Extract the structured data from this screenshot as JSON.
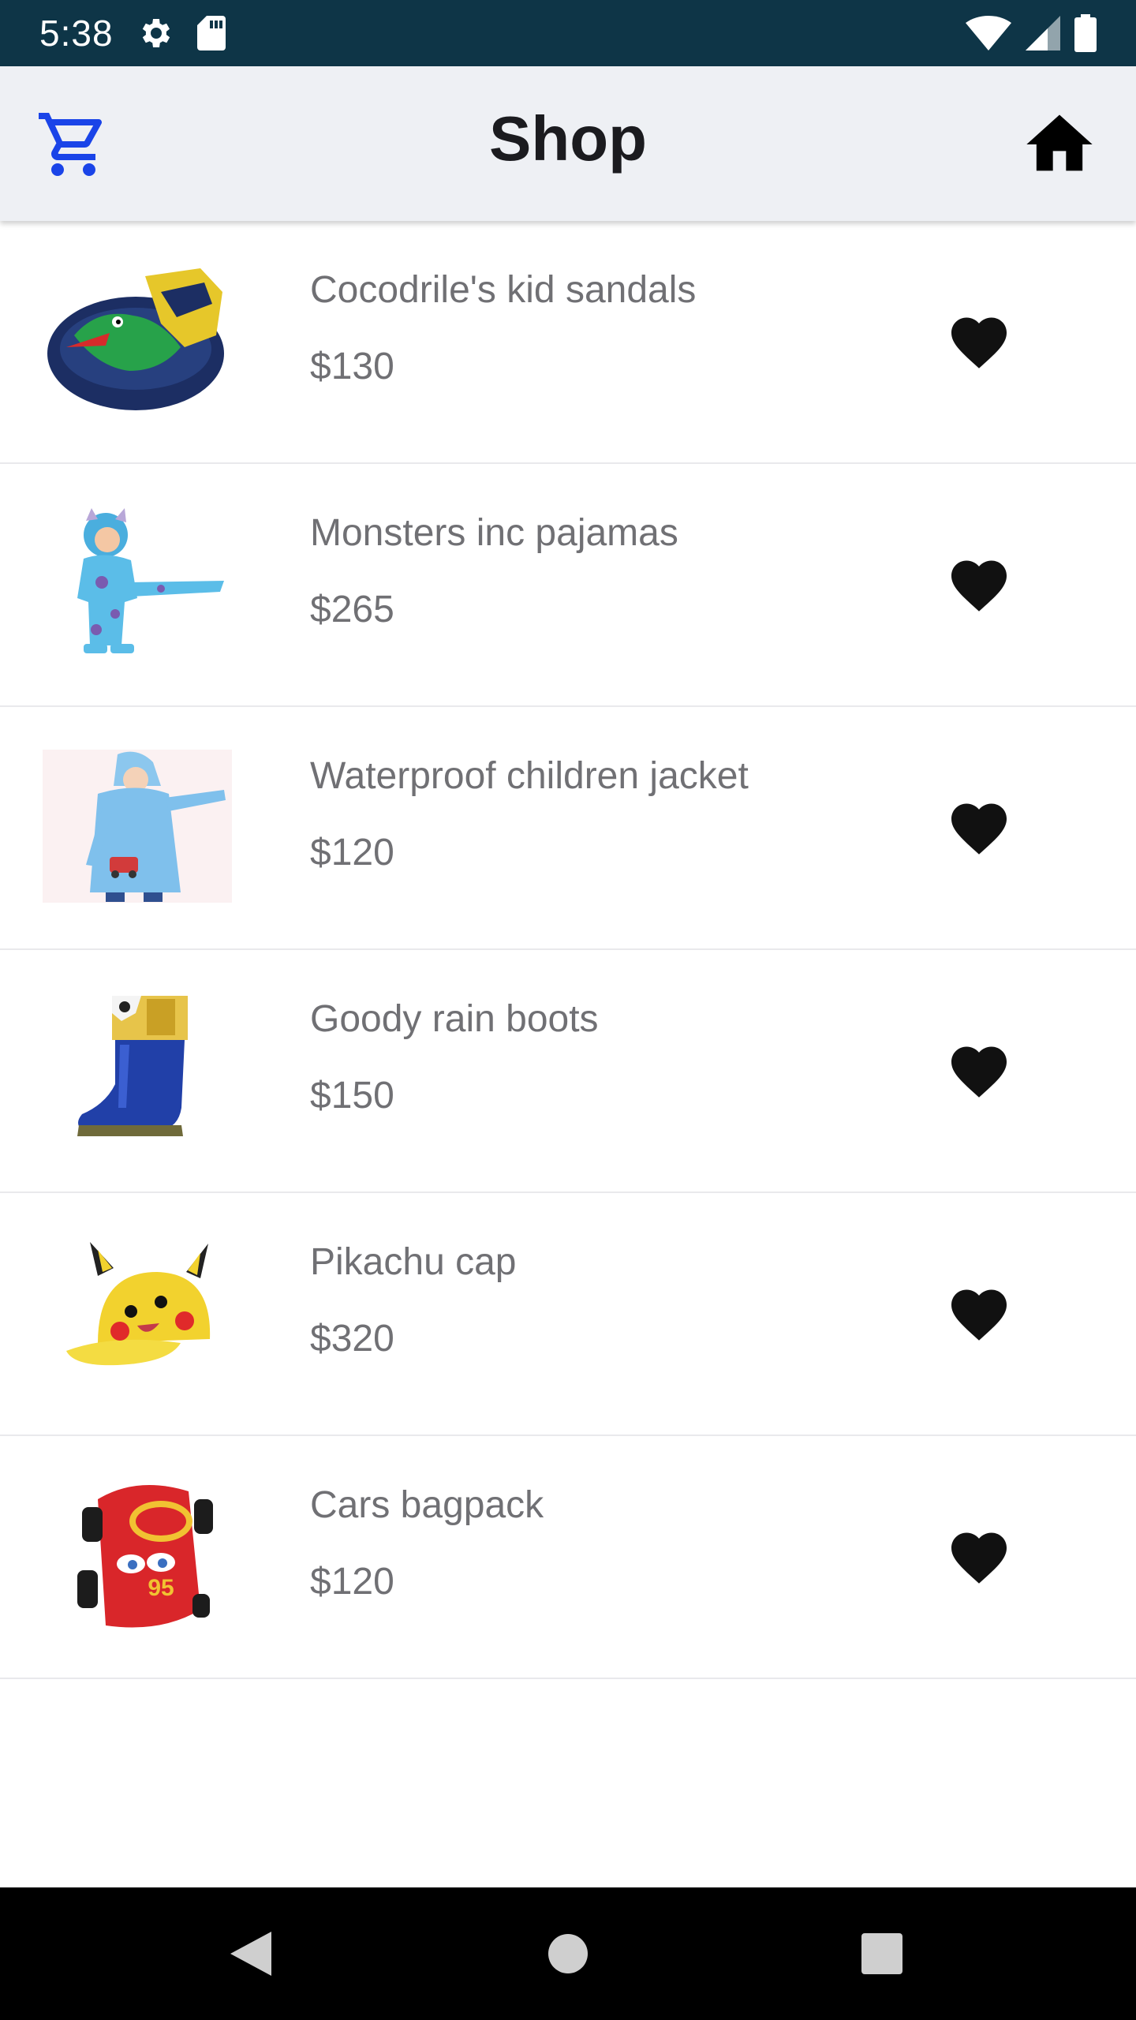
{
  "status_bar": {
    "time": "5:38",
    "icons": [
      "settings-icon",
      "sd-card-icon",
      "wifi-icon",
      "signal-icon",
      "battery-icon"
    ]
  },
  "app_bar": {
    "title": "Shop",
    "cart_icon": "shopping-cart-icon",
    "home_icon": "home-icon",
    "accent_color": "#1a44e8"
  },
  "products": [
    {
      "name": "Cocodrile's kid sandals",
      "price": "$130",
      "image": "sandals",
      "favorite_icon": "heart-icon"
    },
    {
      "name": "Monsters inc pajamas",
      "price": "$265",
      "image": "pajamas",
      "favorite_icon": "heart-icon"
    },
    {
      "name": "Waterproof children jacket",
      "price": "$120",
      "image": "jacket",
      "favorite_icon": "heart-icon"
    },
    {
      "name": "Goody rain boots",
      "price": "$150",
      "image": "boots",
      "favorite_icon": "heart-icon"
    },
    {
      "name": "Pikachu cap",
      "price": "$320",
      "image": "cap",
      "favorite_icon": "heart-icon"
    },
    {
      "name": "Cars bagpack",
      "price": "$120",
      "image": "backpack",
      "favorite_icon": "heart-icon"
    }
  ],
  "nav_bar": {
    "buttons": [
      "back-icon",
      "home-circle-icon",
      "recents-icon"
    ]
  }
}
